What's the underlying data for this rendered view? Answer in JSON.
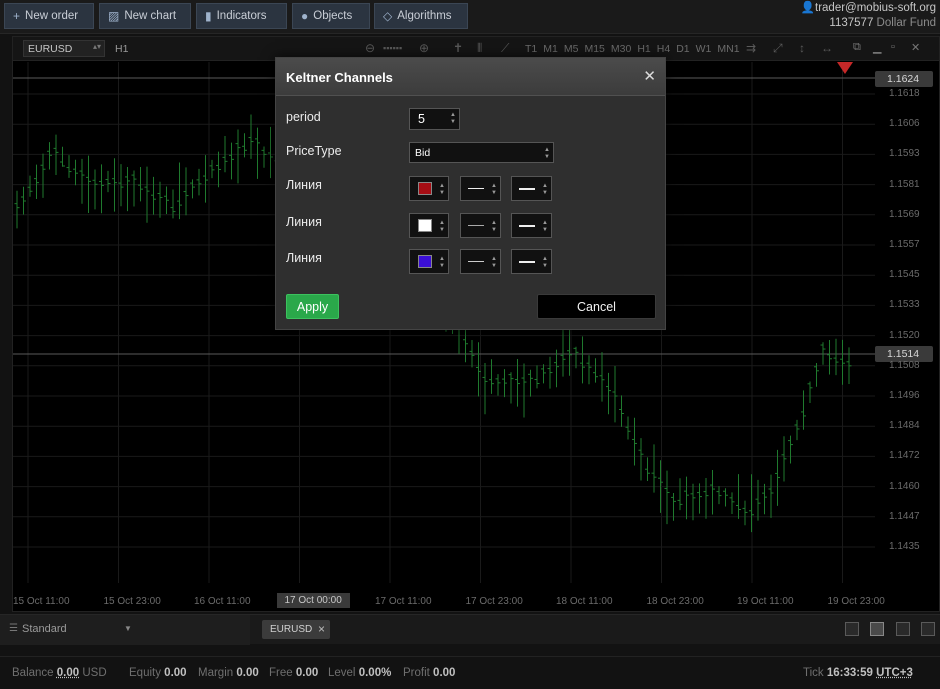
{
  "toolbar": {
    "new_order": "New order",
    "new_chart": "New chart",
    "indicators": "Indicators",
    "objects": "Objects",
    "algorithms": "Algorithms"
  },
  "account": {
    "user": "trader@mobius-soft.org",
    "number": "1137577",
    "name": "Dollar Fund"
  },
  "chart": {
    "symbol": "EURUSD",
    "timeframe": "H1",
    "timeframes": [
      "T1",
      "M1",
      "M5",
      "M15",
      "M30",
      "H1",
      "H4",
      "D1",
      "W1",
      "MN1"
    ],
    "price_labels": [
      "1.1618",
      "1.1606",
      "1.1593",
      "1.1581",
      "1.1569",
      "1.1557",
      "1.1545",
      "1.1533",
      "1.1520",
      "1.1508",
      "1.1496",
      "1.1484",
      "1.1472",
      "1.1460",
      "1.1447",
      "1.1435"
    ],
    "price_tag_top": "1.1624",
    "price_tag_current": "1.1514",
    "time_labels": [
      "15 Oct 11:00",
      "15 Oct 23:00",
      "16 Oct 11:00",
      "17 Oct 00:00",
      "17 Oct 11:00",
      "17 Oct 23:00",
      "18 Oct 11:00",
      "18 Oct 23:00",
      "19 Oct 11:00",
      "19 Oct 23:00"
    ],
    "time_active_index": 3,
    "colors": {
      "candle": "#1f7a2e",
      "grid": "#1a1a1a",
      "line": "#5a5a5a",
      "marker": "#c62828"
    }
  },
  "bottom": {
    "layout": "Standard",
    "tab": "EURUSD"
  },
  "status": {
    "balance_label": "Balance",
    "balance": "0.00",
    "currency": "USD",
    "equity_label": "Equity",
    "equity": "0.00",
    "margin_label": "Margin",
    "margin": "0.00",
    "free_label": "Free",
    "free": "0.00",
    "level_label": "Level",
    "level": "0.00%",
    "profit_label": "Profit",
    "profit": "0.00",
    "tick_label": "Tick",
    "time": "16:33:59",
    "tz": "UTC+3"
  },
  "dialog": {
    "title": "Keltner Channels",
    "period_label": "period",
    "period_value": "5",
    "pricetype_label": "PriceType",
    "pricetype_value": "Bid",
    "line1_label": "Линия",
    "line2_label": "Линия",
    "line3_label": "Линия",
    "line1_color": "#a50d14",
    "line2_color": "#ffffff",
    "line3_color": "#3b0fd6",
    "apply_label": "Apply",
    "cancel_label": "Cancel"
  }
}
